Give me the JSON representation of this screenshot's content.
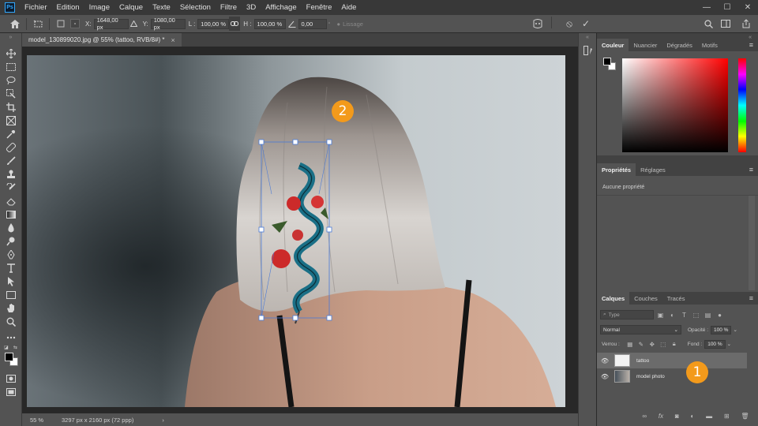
{
  "menubar": {
    "logo": "Ps",
    "items": [
      "Fichier",
      "Edition",
      "Image",
      "Calque",
      "Texte",
      "Sélection",
      "Filtre",
      "3D",
      "Affichage",
      "Fenêtre",
      "Aide"
    ],
    "window_controls": [
      "—",
      "☐",
      "✕"
    ]
  },
  "options_bar": {
    "x_label": "X:",
    "x_value": "1648,00 px",
    "y_label": "Y:",
    "y_value": "1080,00 px",
    "w_label": "L :",
    "w_value": "100,00 %",
    "h_label": "H :",
    "h_value": "100,00 %",
    "angle_value": "0,00",
    "angle_unit": "°",
    "interp_label": "Lissage",
    "cancel_icon": "⦸",
    "commit_icon": "✓"
  },
  "document": {
    "tab_title": "model_130899020.jpg @ 55% (tattoo, RVB/8#) *",
    "close_icon": "×"
  },
  "status_bar": {
    "zoom": "55 %",
    "doc_info": "3297 px x 2160 px (72 ppp)",
    "arrow": "›"
  },
  "color_panel": {
    "tabs": [
      "Couleur",
      "Nuancier",
      "Dégradés",
      "Motifs"
    ],
    "foreground": "#000000",
    "background": "#ffffff"
  },
  "properties_panel": {
    "tabs": [
      "Propriétés",
      "Réglages"
    ],
    "empty_text": "Aucune propriété"
  },
  "layers_panel": {
    "tabs": [
      "Calques",
      "Couches",
      "Tracés"
    ],
    "kind_placeholder": "Type",
    "blend_mode": "Normal",
    "opacity_label": "Opacité :",
    "opacity_value": "100 %",
    "lock_label": "Verrou :",
    "fill_label": "Fond :",
    "fill_value": "100 %",
    "layers": [
      {
        "name": "tattoo",
        "selected": true
      },
      {
        "name": "model photo",
        "selected": false
      }
    ]
  },
  "callouts": [
    "1",
    "2"
  ],
  "colors": {
    "callout": "#f39a1b",
    "selection_handles": "#4a7ad6",
    "app_dark": "#383838",
    "panel": "#535353"
  }
}
